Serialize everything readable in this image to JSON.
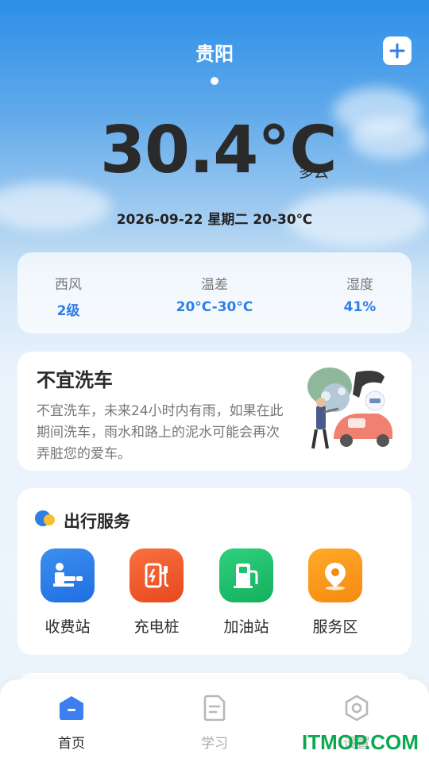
{
  "header": {
    "city": "贵阳",
    "add_icon": "plus-icon"
  },
  "weather": {
    "temperature": "30.4°C",
    "condition": "多云",
    "date_line": "2026-09-22 星期二 20-30℃"
  },
  "stats": [
    {
      "label": "西风",
      "value": "2级"
    },
    {
      "label": "温差",
      "value": "20°C-30°C"
    },
    {
      "label": "湿度",
      "value": "41%"
    }
  ],
  "car_wash": {
    "title": "不宜洗车",
    "description": "不宜洗车，未来24小时内有雨，如果在此期间洗车，雨水和路上的泥水可能会再次弄脏您的爱车。"
  },
  "travel": {
    "title": "出行服务",
    "services": [
      {
        "label": "收费站",
        "icon": "toll-booth-icon",
        "color": "#2f7ee6"
      },
      {
        "label": "充电桩",
        "icon": "charging-pile-icon",
        "color": "#ef5a2a"
      },
      {
        "label": "加油站",
        "icon": "gas-station-icon",
        "color": "#1fbf6e"
      },
      {
        "label": "服务区",
        "icon": "service-area-icon",
        "color": "#fa9216"
      }
    ]
  },
  "tabbar": {
    "tabs": [
      {
        "label": "首页",
        "icon": "home-icon",
        "active": true
      },
      {
        "label": "学习",
        "icon": "document-icon",
        "active": false
      },
      {
        "label": "设置",
        "icon": "settings-icon",
        "active": false
      }
    ]
  },
  "watermark": "ITMOP.COM",
  "colors": {
    "accent": "#2f7ee6",
    "text": "#2a2a2a",
    "muted": "#777777"
  }
}
